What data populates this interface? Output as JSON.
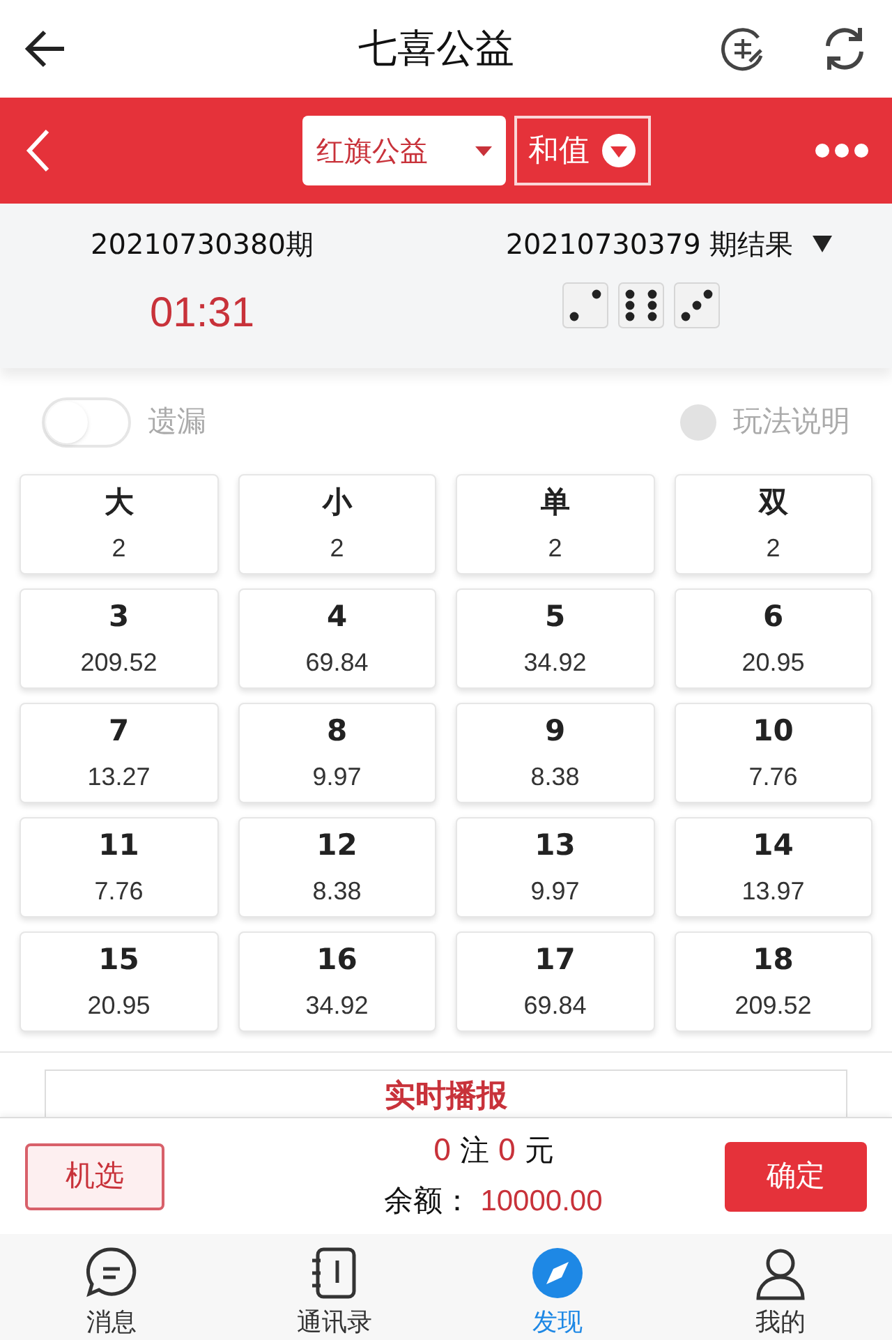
{
  "header": {
    "title": "七喜公益"
  },
  "sub_bar": {
    "lottery": "红旗公益",
    "play": "和值"
  },
  "draw": {
    "current_issue": "20210730380期",
    "countdown": "01:31",
    "last_result": "20210730379 期结果",
    "dice": [
      {
        "kind": "two"
      },
      {
        "kind": "six"
      },
      {
        "kind": "three"
      }
    ]
  },
  "options": {
    "missing_toggle": {
      "label": "遗漏",
      "on": false
    },
    "help": "玩法说明"
  },
  "bets": [
    {
      "name": "大",
      "odds": "2"
    },
    {
      "name": "小",
      "odds": "2"
    },
    {
      "name": "单",
      "odds": "2"
    },
    {
      "name": "双",
      "odds": "2"
    },
    {
      "name": "3",
      "odds": "209.52"
    },
    {
      "name": "4",
      "odds": "69.84"
    },
    {
      "name": "5",
      "odds": "34.92"
    },
    {
      "name": "6",
      "odds": "20.95"
    },
    {
      "name": "7",
      "odds": "13.27"
    },
    {
      "name": "8",
      "odds": "9.97"
    },
    {
      "name": "9",
      "odds": "8.38"
    },
    {
      "name": "10",
      "odds": "7.76"
    },
    {
      "name": "11",
      "odds": "7.76"
    },
    {
      "name": "12",
      "odds": "8.38"
    },
    {
      "name": "13",
      "odds": "9.97"
    },
    {
      "name": "14",
      "odds": "13.97"
    },
    {
      "name": "15",
      "odds": "20.95"
    },
    {
      "name": "16",
      "odds": "34.92"
    },
    {
      "name": "17",
      "odds": "69.84"
    },
    {
      "name": "18",
      "odds": "209.52"
    }
  ],
  "broadcast": {
    "title": "实时播报"
  },
  "footer": {
    "random_button": "机选",
    "count": "0",
    "count_unit": "注",
    "amount": "0",
    "amount_unit": "元",
    "balance_label": "余额：",
    "balance": "10000.00",
    "confirm_button": "确定"
  },
  "nav": [
    {
      "kind": "chat",
      "label": "消息",
      "selected": false
    },
    {
      "kind": "contacts",
      "label": "通讯录",
      "selected": false
    },
    {
      "kind": "compass",
      "label": "发现",
      "selected": true
    },
    {
      "kind": "person",
      "label": "我的",
      "selected": false
    }
  ]
}
